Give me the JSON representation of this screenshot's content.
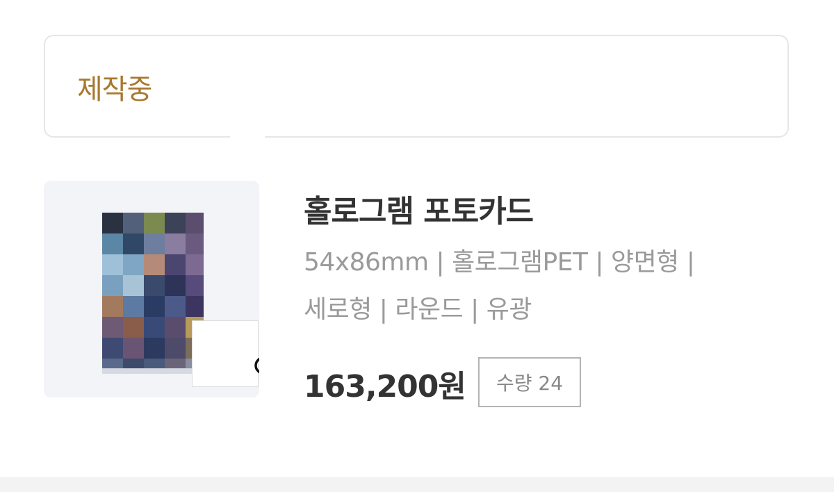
{
  "status": {
    "label": "제작중"
  },
  "product": {
    "name": "홀로그램 포토카드",
    "spec_line_1": "54x86mm | 홀로그램PET | 양면형 |",
    "spec_line_2": "세로형 | 라운드 | 유광",
    "price": "163,200원",
    "quantity": "수량 24",
    "thumbnail_icon": "photo-card-thumbnail",
    "zoom_icon": "search-icon"
  },
  "colors": {
    "accent": "#a8782f",
    "text_primary": "#333333",
    "text_secondary": "#9a9a9a",
    "card_border": "#e6e6e6",
    "thumb_bg": "#f3f4f8"
  }
}
